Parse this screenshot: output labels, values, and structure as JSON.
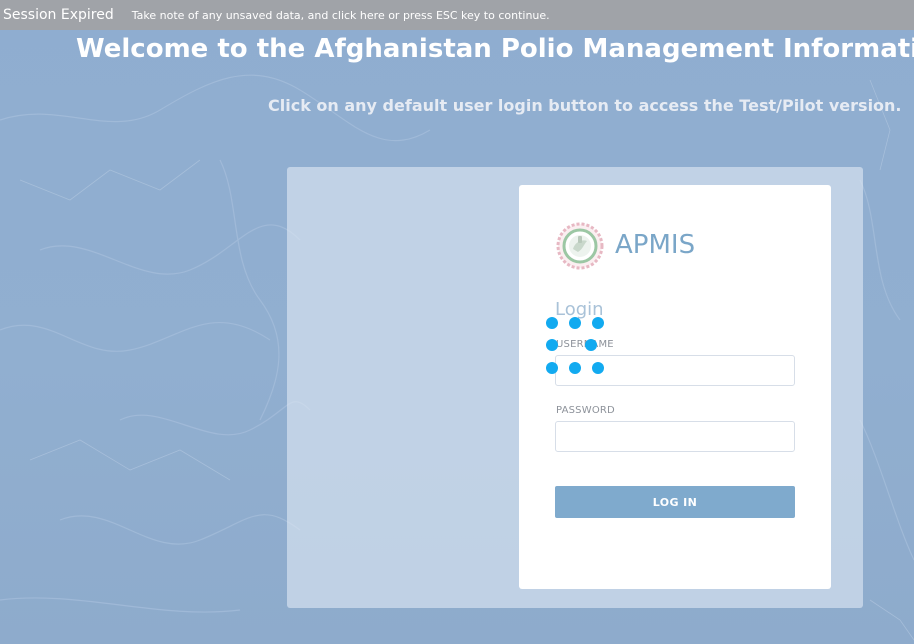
{
  "session": {
    "title": "Session Expired",
    "message": "Take note of any unsaved data, and click here or press ESC key to continue."
  },
  "header": {
    "welcome": "Welcome to the Afghanistan Polio Management Information Sys",
    "subtitle": "Click on any default user login button to access the Test/Pilot version."
  },
  "login": {
    "brand": "APMIS",
    "heading": "Login",
    "username_label": "USERNAME",
    "username_value": "",
    "password_label": "PASSWORD",
    "password_value": "",
    "button_label": "LOG IN"
  },
  "icons": {
    "logo": "apmis-logo-icon",
    "spinner": "loading-spinner-icon"
  },
  "colors": {
    "background": "#8fadd0",
    "session_bar": "#a0a3a8",
    "brand": "#7aa6c8",
    "button": "#7faacd",
    "spinner": "#12aaf0"
  }
}
